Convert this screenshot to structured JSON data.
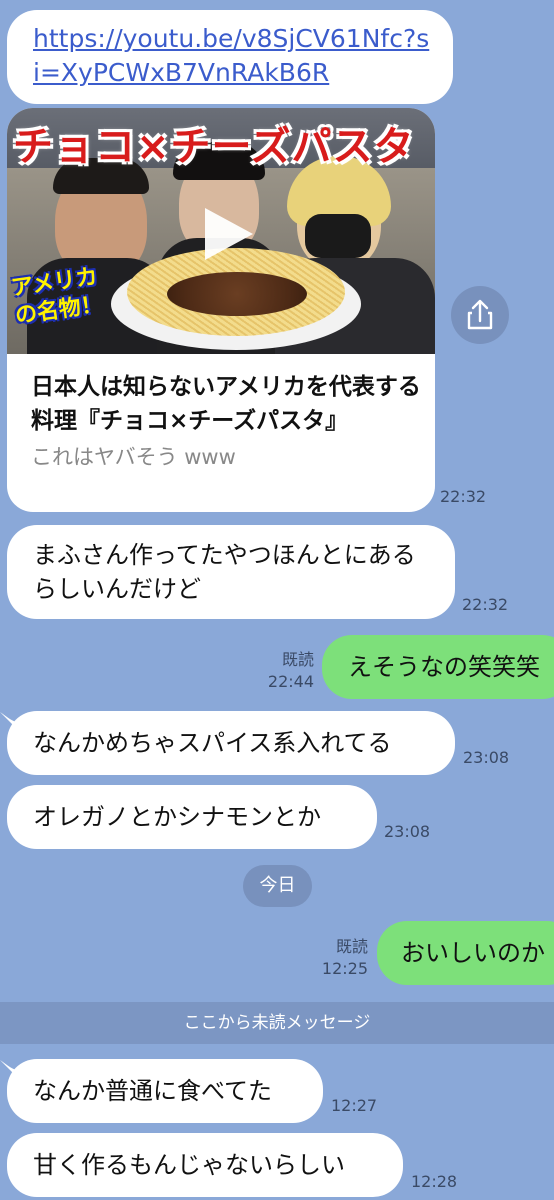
{
  "messages": {
    "link": {
      "url": "https://youtu.be/v8SjCV61Nfc?si=XyPCWxB7VnRAkB6R"
    },
    "video_card": {
      "thumbnail_title": "チョコ×チーズパスタ",
      "thumbnail_badge": "アメリカの名物！",
      "title": "日本人は知らないアメリカを代表する料理『チョコ×チーズパスタ』",
      "description": "これはヤバそう www",
      "time": "22:32"
    },
    "m1": {
      "text": "まふさん作ってたやつほんとにあるらしいんだけど",
      "time": "22:32"
    },
    "m2": {
      "text": "えそうなの笑笑笑",
      "read": "既読",
      "time": "22:44"
    },
    "m3": {
      "text": "なんかめちゃスパイス系入れてる",
      "time": "23:08"
    },
    "m4": {
      "text": "オレガノとかシナモンとか",
      "time": "23:08"
    },
    "date_separator": "今日",
    "m5": {
      "text": "おいしいのか",
      "read": "既読",
      "time": "12:25"
    },
    "unread_separator": "ここから未読メッセージ",
    "m6": {
      "text": "なんか普通に食べてた",
      "time": "12:27"
    },
    "m7": {
      "text": "甘く作るもんじゃないらしい",
      "time": "12:28"
    }
  },
  "colors": {
    "background": "#8aa8d8",
    "incoming_bubble": "#ffffff",
    "outgoing_bubble": "#7de07a",
    "link": "#3b5ccc"
  },
  "icons": {
    "share": "share-icon",
    "play": "play-icon"
  }
}
